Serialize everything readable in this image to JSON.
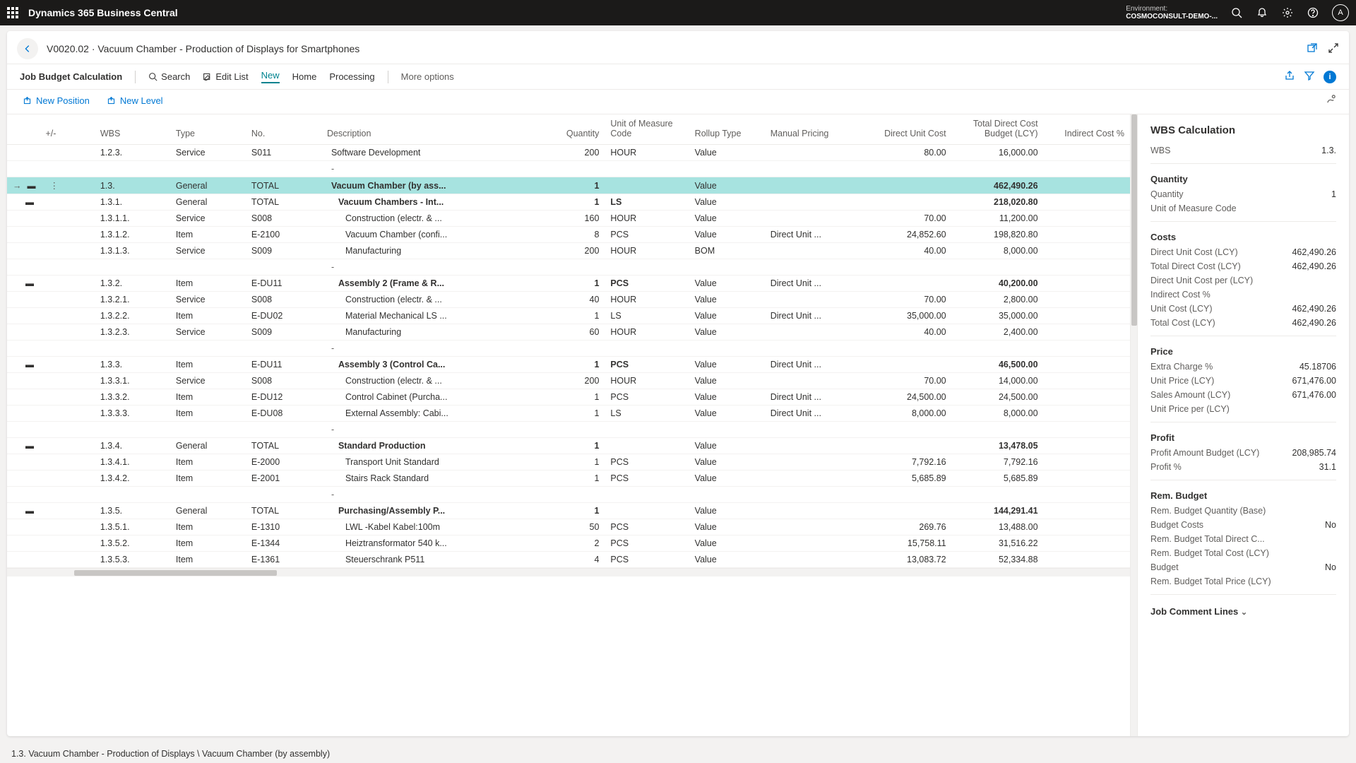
{
  "topbar": {
    "app_title": "Dynamics 365 Business Central",
    "env_label": "Environment:",
    "env_value": "COSMOCONSULT-DEMO-...",
    "avatar": "A"
  },
  "page_header": {
    "crumb": "V0020.02 · Vacuum Chamber - Production of Displays for Smartphones"
  },
  "cmdbar": {
    "title": "Job Budget Calculation",
    "search": "Search",
    "edit_list": "Edit List",
    "new": "New",
    "home": "Home",
    "processing": "Processing",
    "more": "More options"
  },
  "subbar": {
    "new_position": "New Position",
    "new_level": "New Level"
  },
  "columns": {
    "plusminus": "+/-",
    "wbs": "WBS",
    "type": "Type",
    "no": "No.",
    "description": "Description",
    "quantity": "Quantity",
    "uom": "Unit of Measure Code",
    "rollup": "Rollup Type",
    "manual_pricing": "Manual Pricing",
    "direct_unit_cost": "Direct Unit Cost",
    "tdcb": "Total Direct Cost Budget (LCY)",
    "indirect": "Indirect Cost %"
  },
  "rows": [
    {
      "kind": "row",
      "wbs": "1.2.3.",
      "type": "Service",
      "no": "S011",
      "desc": "Software Development",
      "qty": "200",
      "uom": "HOUR",
      "rollup": "Value",
      "mp": "",
      "duc": "80.00",
      "tdcb": "16,000.00",
      "indent": 0
    },
    {
      "kind": "spacer",
      "desc": "-"
    },
    {
      "kind": "row",
      "selected": true,
      "bold": true,
      "collapse": true,
      "wbs": "1.3.",
      "type": "General",
      "no": "TOTAL",
      "desc": "Vacuum Chamber (by ass...",
      "qty": "1",
      "uom": "",
      "rollup": "Value",
      "mp": "",
      "duc": "",
      "tdcb": "462,490.26",
      "indent": 0
    },
    {
      "kind": "row",
      "bold": true,
      "collapse": true,
      "wbs": "1.3.1.",
      "type": "General",
      "no": "TOTAL",
      "desc": "Vacuum Chambers - Int...",
      "qty": "1",
      "uom": "LS",
      "rollup": "Value",
      "mp": "",
      "duc": "",
      "tdcb": "218,020.80",
      "indent": 1
    },
    {
      "kind": "row",
      "wbs": "1.3.1.1.",
      "type": "Service",
      "no": "S008",
      "desc": "Construction (electr. & ...",
      "qty": "160",
      "uom": "HOUR",
      "rollup": "Value",
      "mp": "",
      "duc": "70.00",
      "tdcb": "11,200.00",
      "indent": 2
    },
    {
      "kind": "row",
      "wbs": "1.3.1.2.",
      "type": "Item",
      "no": "E-2100",
      "desc": "Vacuum Chamber (confi...",
      "qty": "8",
      "uom": "PCS",
      "rollup": "Value",
      "mp": "Direct Unit ...",
      "duc": "24,852.60",
      "tdcb": "198,820.80",
      "indent": 2
    },
    {
      "kind": "row",
      "wbs": "1.3.1.3.",
      "type": "Service",
      "no": "S009",
      "desc": "Manufacturing",
      "qty": "200",
      "uom": "HOUR",
      "rollup": "BOM",
      "mp": "",
      "duc": "40.00",
      "tdcb": "8,000.00",
      "indent": 2
    },
    {
      "kind": "spacer",
      "desc": "-"
    },
    {
      "kind": "row",
      "bold": true,
      "collapse": true,
      "wbs": "1.3.2.",
      "type": "Item",
      "no": "E-DU11",
      "desc": "Assembly 2 (Frame & R...",
      "qty": "1",
      "uom": "PCS",
      "rollup": "Value",
      "mp": "Direct Unit ...",
      "duc": "",
      "tdcb": "40,200.00",
      "indent": 1
    },
    {
      "kind": "row",
      "wbs": "1.3.2.1.",
      "type": "Service",
      "no": "S008",
      "desc": "Construction (electr. & ...",
      "qty": "40",
      "uom": "HOUR",
      "rollup": "Value",
      "mp": "",
      "duc": "70.00",
      "tdcb": "2,800.00",
      "indent": 2
    },
    {
      "kind": "row",
      "wbs": "1.3.2.2.",
      "type": "Item",
      "no": "E-DU02",
      "desc": "Material Mechanical LS ...",
      "qty": "1",
      "uom": "LS",
      "rollup": "Value",
      "mp": "Direct Unit ...",
      "duc": "35,000.00",
      "tdcb": "35,000.00",
      "indent": 2
    },
    {
      "kind": "row",
      "wbs": "1.3.2.3.",
      "type": "Service",
      "no": "S009",
      "desc": "Manufacturing",
      "qty": "60",
      "uom": "HOUR",
      "rollup": "Value",
      "mp": "",
      "duc": "40.00",
      "tdcb": "2,400.00",
      "indent": 2
    },
    {
      "kind": "spacer",
      "desc": "-"
    },
    {
      "kind": "row",
      "bold": true,
      "collapse": true,
      "wbs": "1.3.3.",
      "type": "Item",
      "no": "E-DU11",
      "desc": "Assembly 3 (Control Ca...",
      "qty": "1",
      "uom": "PCS",
      "rollup": "Value",
      "mp": "Direct Unit ...",
      "duc": "",
      "tdcb": "46,500.00",
      "indent": 1
    },
    {
      "kind": "row",
      "wbs": "1.3.3.1.",
      "type": "Service",
      "no": "S008",
      "desc": "Construction (electr. & ...",
      "qty": "200",
      "uom": "HOUR",
      "rollup": "Value",
      "mp": "",
      "duc": "70.00",
      "tdcb": "14,000.00",
      "indent": 2
    },
    {
      "kind": "row",
      "wbs": "1.3.3.2.",
      "type": "Item",
      "no": "E-DU12",
      "desc": "Control Cabinet (Purcha...",
      "qty": "1",
      "uom": "PCS",
      "rollup": "Value",
      "mp": "Direct Unit ...",
      "duc": "24,500.00",
      "tdcb": "24,500.00",
      "indent": 2
    },
    {
      "kind": "row",
      "wbs": "1.3.3.3.",
      "type": "Item",
      "no": "E-DU08",
      "desc": "External Assembly: Cabi...",
      "qty": "1",
      "uom": "LS",
      "rollup": "Value",
      "mp": "Direct Unit ...",
      "duc": "8,000.00",
      "tdcb": "8,000.00",
      "indent": 2
    },
    {
      "kind": "spacer",
      "desc": "-"
    },
    {
      "kind": "row",
      "bold": true,
      "collapse": true,
      "wbs": "1.3.4.",
      "type": "General",
      "no": "TOTAL",
      "desc": "Standard Production",
      "qty": "1",
      "uom": "",
      "rollup": "Value",
      "mp": "",
      "duc": "",
      "tdcb": "13,478.05",
      "indent": 1
    },
    {
      "kind": "row",
      "wbs": "1.3.4.1.",
      "type": "Item",
      "no": "E-2000",
      "desc": "Transport Unit Standard",
      "qty": "1",
      "uom": "PCS",
      "rollup": "Value",
      "mp": "",
      "duc": "7,792.16",
      "tdcb": "7,792.16",
      "indent": 2
    },
    {
      "kind": "row",
      "wbs": "1.3.4.2.",
      "type": "Item",
      "no": "E-2001",
      "desc": "Stairs Rack Standard",
      "qty": "1",
      "uom": "PCS",
      "rollup": "Value",
      "mp": "",
      "duc": "5,685.89",
      "tdcb": "5,685.89",
      "indent": 2
    },
    {
      "kind": "spacer",
      "desc": "-"
    },
    {
      "kind": "row",
      "bold": true,
      "collapse": true,
      "wbs": "1.3.5.",
      "type": "General",
      "no": "TOTAL",
      "desc": "Purchasing/Assembly P...",
      "qty": "1",
      "uom": "",
      "rollup": "Value",
      "mp": "",
      "duc": "",
      "tdcb": "144,291.41",
      "indent": 1
    },
    {
      "kind": "row",
      "wbs": "1.3.5.1.",
      "type": "Item",
      "no": "E-1310",
      "desc": "LWL -Kabel Kabel:100m",
      "qty": "50",
      "uom": "PCS",
      "rollup": "Value",
      "mp": "",
      "duc": "269.76",
      "tdcb": "13,488.00",
      "indent": 2
    },
    {
      "kind": "row",
      "wbs": "1.3.5.2.",
      "type": "Item",
      "no": "E-1344",
      "desc": "Heiztransformator 540 k...",
      "qty": "2",
      "uom": "PCS",
      "rollup": "Value",
      "mp": "",
      "duc": "15,758.11",
      "tdcb": "31,516.22",
      "indent": 2
    },
    {
      "kind": "row",
      "wbs": "1.3.5.3.",
      "type": "Item",
      "no": "E-1361",
      "desc": "Steuerschrank P511",
      "qty": "4",
      "uom": "PCS",
      "rollup": "Value",
      "mp": "",
      "duc": "13,083.72",
      "tdcb": "52,334.88",
      "indent": 2
    }
  ],
  "sidebar": {
    "title": "WBS Calculation",
    "wbs": {
      "label": "WBS",
      "value": "1.3."
    },
    "quantity_head": "Quantity",
    "quantity": {
      "label": "Quantity",
      "value": "1"
    },
    "uom": {
      "label": "Unit of Measure Code",
      "value": ""
    },
    "costs_head": "Costs",
    "costs": [
      {
        "label": "Direct Unit Cost (LCY)",
        "value": "462,490.26"
      },
      {
        "label": "Total Direct Cost (LCY)",
        "value": "462,490.26"
      },
      {
        "label": "Direct Unit Cost per (LCY)",
        "value": ""
      },
      {
        "label": "Indirect Cost %",
        "value": ""
      },
      {
        "label": "Unit Cost (LCY)",
        "value": "462,490.26"
      },
      {
        "label": "Total Cost (LCY)",
        "value": "462,490.26"
      }
    ],
    "price_head": "Price",
    "price": [
      {
        "label": "Extra Charge %",
        "value": "45.18706"
      },
      {
        "label": "Unit Price (LCY)",
        "value": "671,476.00"
      },
      {
        "label": "Sales Amount (LCY)",
        "value": "671,476.00"
      },
      {
        "label": "Unit Price per (LCY)",
        "value": ""
      }
    ],
    "profit_head": "Profit",
    "profit": [
      {
        "label": "Profit Amount Budget (LCY)",
        "value": "208,985.74"
      },
      {
        "label": "Profit %",
        "value": "31.1"
      }
    ],
    "rem_head": "Rem. Budget",
    "rem": [
      {
        "label": "Rem. Budget Quantity (Base)",
        "value": ""
      },
      {
        "label": "Budget Costs",
        "value": "No"
      },
      {
        "label": "Rem. Budget Total Direct C...",
        "value": ""
      },
      {
        "label": "Rem. Budget Total Cost (LCY)",
        "value": ""
      },
      {
        "label": "Budget",
        "value": "No"
      },
      {
        "label": "Rem. Budget Total Price (LCY)",
        "value": ""
      }
    ],
    "comments_head": "Job Comment Lines"
  },
  "footer": "1.3. Vacuum Chamber - Production of Displays \\ Vacuum Chamber (by assembly)"
}
